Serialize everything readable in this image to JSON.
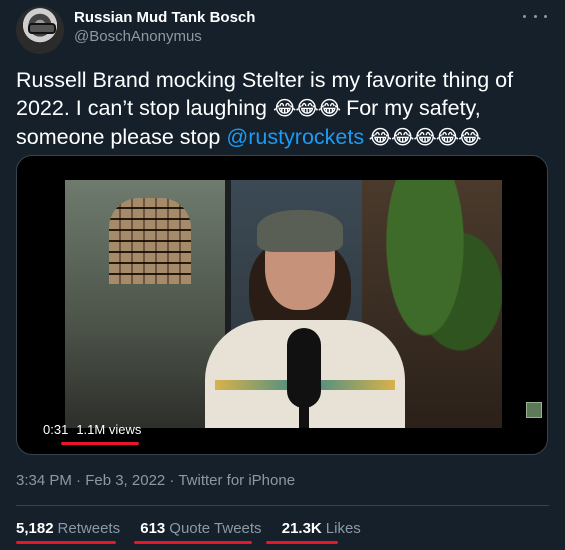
{
  "author": {
    "name": "Russian Mud Tank Bosch",
    "handle": "@BoschAnonymus"
  },
  "tweet": {
    "text_1": "Russell Brand mocking Stelter is my favorite thing of 2022. I can’t stop laughing ",
    "emoji_1": "😂😂😂",
    "text_2": " For my safety, someone please stop ",
    "mention": "@rustyrockets",
    "emoji_2": " 😂😂😂😂😂"
  },
  "video": {
    "duration": "0:31",
    "views": "1.1M views"
  },
  "meta": {
    "time_date": "3:34 PM · Feb 3, 2022 · ",
    "client": "Twitter for iPhone"
  },
  "stats": {
    "retweets_count": "5,182",
    "retweets_label": "Retweets",
    "quotes_count": "613",
    "quotes_label": "Quote Tweets",
    "likes_count": "21.3K",
    "likes_label": "Likes"
  },
  "colors": {
    "background": "#15202b",
    "accent_link": "#1d9bf0",
    "secondary_text": "#8b98a5",
    "annotation_red": "#e8152b"
  }
}
